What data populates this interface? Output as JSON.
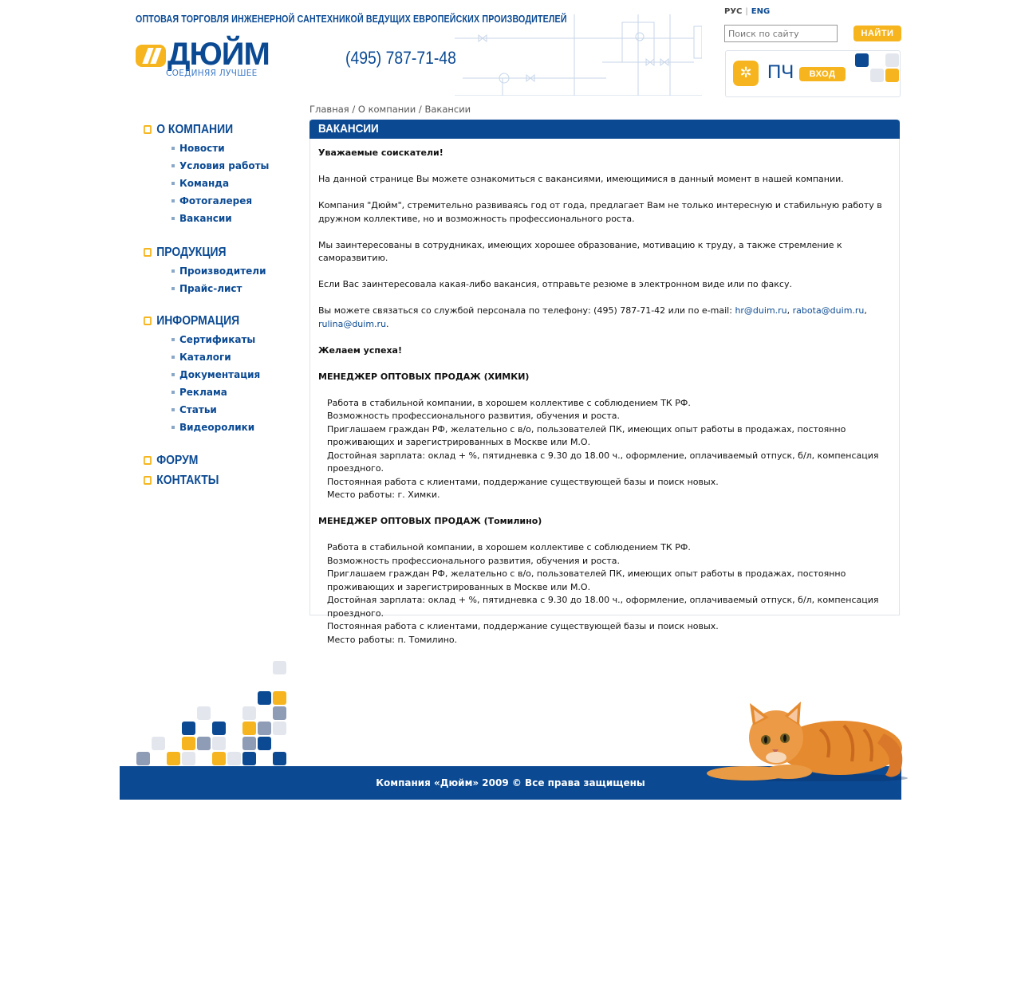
{
  "header": {
    "tagline": "ОПТОВАЯ ТОРГОВЛЯ ИНЖЕНЕРНОЙ САНТЕХНИКОЙ ВЕДУЩИХ ЕВРОПЕЙСКИХ ПРОИЗВОДИТЕЛЕЙ",
    "logo_text": "ДЮЙМ",
    "logo_slogan": "СОЕДИНЯЯ ЛУЧШЕЕ",
    "phone": "(495) 787-71-48",
    "lang_ru": "РУС",
    "lang_sep": "|",
    "lang_en": "ENG",
    "search_placeholder": "Поиск по сайту",
    "search_button": "НАЙТИ",
    "pch_label": "ПЧ",
    "login_button": "ВХОД"
  },
  "breadcrumb": "Главная / О компании / Вакансии",
  "nav": {
    "s1": {
      "title": "О КОМПАНИИ",
      "items": [
        "Новости",
        "Условия работы",
        "Команда",
        "Фотогалерея",
        "Вакансии"
      ]
    },
    "s2": {
      "title": "ПРОДУКЦИЯ",
      "items": [
        "Производители",
        "Прайс-лист"
      ]
    },
    "s3": {
      "title": "ИНФОРМАЦИЯ",
      "items": [
        "Сертификаты",
        "Каталоги",
        "Документация",
        "Реклама",
        "Статьи",
        "Видеоролики"
      ]
    },
    "forum": "ФОРУМ",
    "contacts": "КОНТАКТЫ"
  },
  "content": {
    "title": "ВАКАНСИИ",
    "greeting": "Уважаемые соискатели!",
    "p1": "На данной странице Вы можете ознакомиться с вакансиями, имеющимися в данный момент в нашей компании.",
    "p2": "Компания \"Дюйм\", стремительно развиваясь год от года, предлагает Вам не только интересную и стабильную работу в дружном коллективе, но и возможность профессионального роста.",
    "p3": "Мы заинтересованы в сотрудниках, имеющих хорошее образование, мотивацию к труду, а также стремление к саморазвитию.",
    "p4": "Если Вас заинтересовала какая-либо вакансия, отправьте резюме в электронном виде или по факсу.",
    "p5": "Вы можете связаться со службой персонала по телефону: (495) 787-71-42 или по e-mail:",
    "email1": "hr@duim.ru",
    "email2": "rabota@duim.ru",
    "email3": "rulina@duim.ru",
    "comma": ",",
    "dot": ".",
    "wish": "Желаем успеха!",
    "vac1": {
      "title": "МЕНЕДЖЕР ОПТОВЫХ ПРОДАЖ (ХИМКИ)",
      "lines": [
        "Работа в стабильной компании, в хорошем коллективе с соблюдением ТК РФ.",
        "Возможность профессионального развития, обучения и роста.",
        "Приглашаем граждан РФ, желательно с в/о, пользователей ПК, имеющих опыт работы в продажах, постоянно проживающих и зарегистрированных в Москве или М.О.",
        "Достойная зарплата: оклад + %, пятидневка с 9.30 до 18.00 ч., оформление, оплачиваемый отпуск, б/л, компенсация проездного.",
        "Постоянная работа с клиентами, поддержание существующей базы и поиск новых.",
        "Место работы: г. Химки."
      ]
    },
    "vac2": {
      "title": "МЕНЕДЖЕР ОПТОВЫХ ПРОДАЖ (Томилино)",
      "lines": [
        "Работа в стабильной компании, в хорошем коллективе с соблюдением ТК РФ.",
        "Возможность профессионального развития, обучения и роста.",
        "Приглашаем граждан РФ, желательно с в/о, пользователей ПК, имеющих опыт работы в продажах, постоянно проживающих и зарегистрированных в Москве или М.О.",
        "Достойная зарплата: оклад + %, пятидневка с 9.30 до 18.00 ч., оформление, оплачиваемый отпуск, б/л, компенсация проездного.",
        "Постоянная работа с клиентами, поддержание существующей базы и поиск новых.",
        "Место работы: п. Томилино."
      ]
    }
  },
  "footer": {
    "copyright": "Компания «Дюйм» 2009 © Все права защищены"
  },
  "colors": {
    "brand_blue": "#0b4a93",
    "brand_yellow": "#f6b51e",
    "tile_grey": "#8f9cb5",
    "tile_light": "#e3e7ed"
  }
}
